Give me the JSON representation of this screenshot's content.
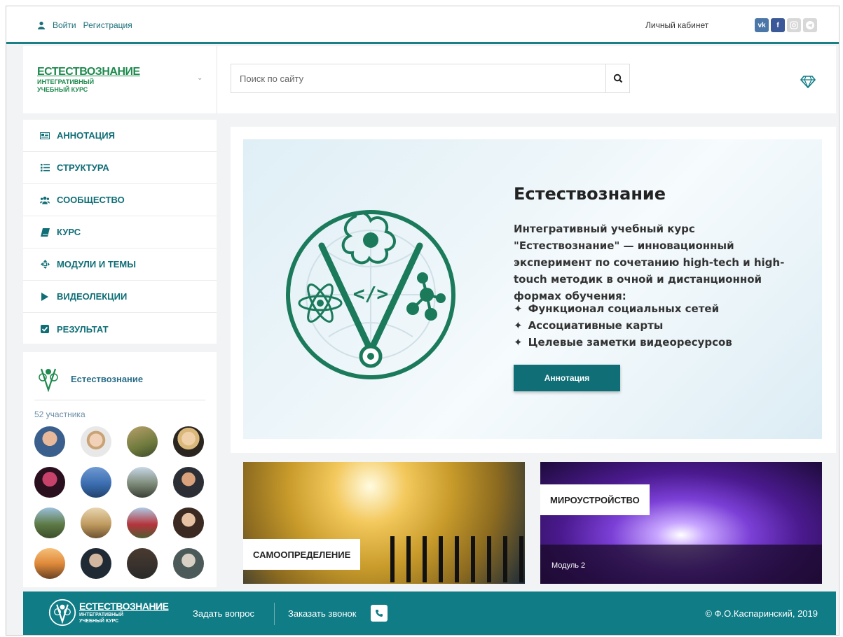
{
  "topbar": {
    "login": "Войти",
    "register": "Регистрация",
    "cabinet": "Личный кабинет",
    "socials": [
      {
        "name": "vk",
        "label": "vk"
      },
      {
        "name": "facebook",
        "label": "f"
      },
      {
        "name": "instagram",
        "label": ""
      },
      {
        "name": "telegram",
        "label": ""
      }
    ]
  },
  "brand": {
    "line1": "ЕСТЕСТВОЗНАНИЕ",
    "line2": "ИНТЕГРАТИВНЫЙ",
    "line3": "УЧЕБНЫЙ КУРС"
  },
  "search": {
    "placeholder": "Поиск по сайту"
  },
  "nav": {
    "items": [
      {
        "label": "АННОТАЦИЯ",
        "icon": "newspaper-icon"
      },
      {
        "label": "СТРУКТУРА",
        "icon": "list-icon"
      },
      {
        "label": "СООБЩЕСТВО",
        "icon": "users-icon"
      },
      {
        "label": "КУРС",
        "icon": "book-icon"
      },
      {
        "label": "МОДУЛИ И ТЕМЫ",
        "icon": "arrows-icon"
      },
      {
        "label": "ВИДЕОЛЕКЦИИ",
        "icon": "play-icon"
      },
      {
        "label": "РЕЗУЛЬТАТ",
        "icon": "check-square-icon"
      }
    ]
  },
  "community": {
    "name": "Естествознание",
    "members": "52 участника"
  },
  "hero": {
    "title": "Естествознание",
    "description": "Интегративный учебный курс \"Естествознание\" — инновационный эксперимент по сочетанию high-tech и high-touch методик в очной и дистанционной формах обучения:",
    "features": [
      "Функционал социальных сетей",
      "Ассоциативные карты",
      "Целевые заметки видеоресурсов"
    ],
    "button": "Аннотация"
  },
  "cards": {
    "card1": {
      "title": "САМООПРЕДЕЛЕНИЕ"
    },
    "card2": {
      "title": "МИРОУСТРОЙСТВО",
      "subtitle": "Модуль 2"
    }
  },
  "footer": {
    "ask": "Задать вопрос",
    "call": "Заказать звонок",
    "copyright": "© Ф.О.Каспаринский, 2019"
  },
  "colors": {
    "accent": "#0f6e76",
    "footer": "#0f7c86",
    "brand_green": "#1e8a4d"
  }
}
